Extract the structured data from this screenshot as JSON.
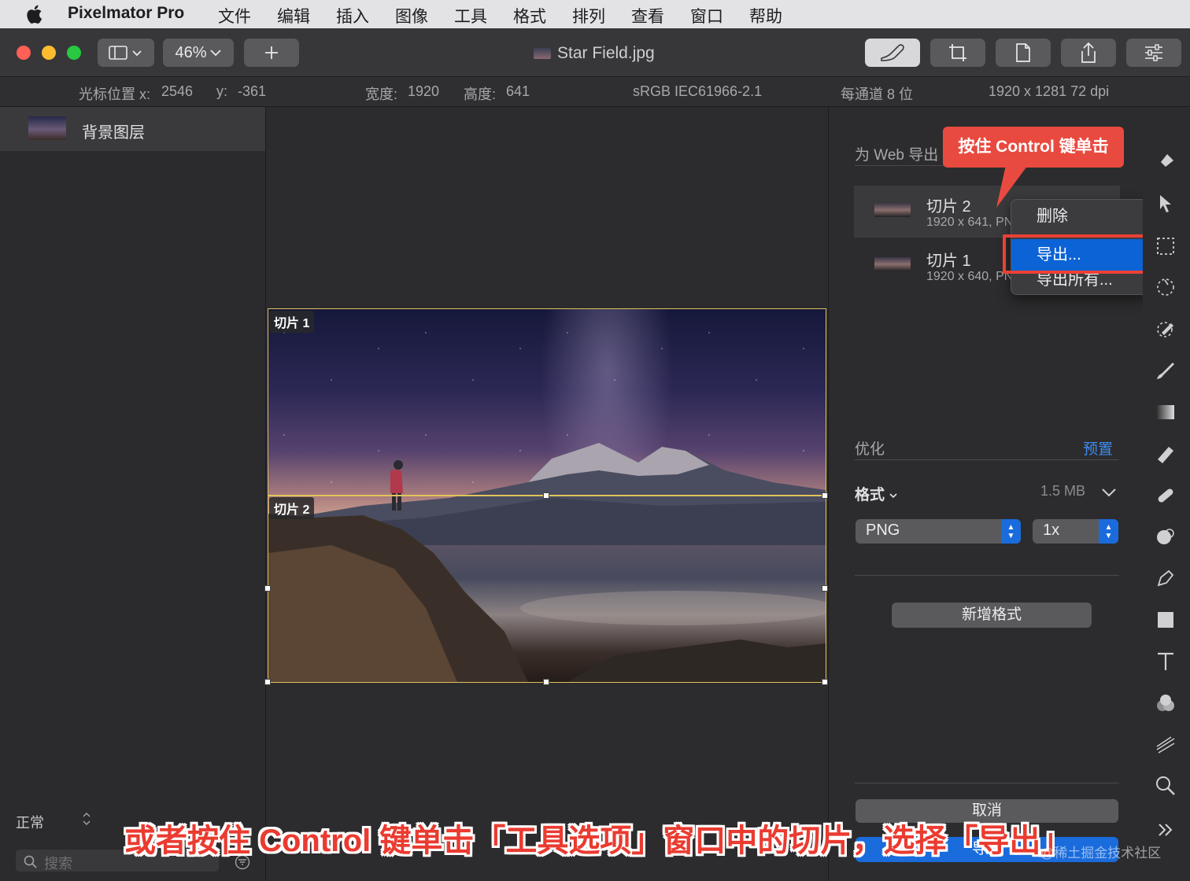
{
  "menubar": {
    "app_name": "Pixelmator Pro",
    "items": [
      "文件",
      "编辑",
      "插入",
      "图像",
      "工具",
      "格式",
      "排列",
      "查看",
      "窗口",
      "帮助"
    ]
  },
  "toolbar": {
    "zoom": "46%",
    "document_title": "Star Field.jpg",
    "traffic_colors": [
      "#fe5f57",
      "#febc2e",
      "#28c840"
    ]
  },
  "infobar": {
    "cursor_x_label": "光标位置 x:",
    "cursor_x": "2546",
    "cursor_y_label": "y:",
    "cursor_y": "-361",
    "width_label": "宽度:",
    "width": "1920",
    "height_label": "高度:",
    "height": "641",
    "color_profile": "sRGB IEC61966-2.1",
    "bit_depth": "每通道 8 位",
    "image_size": "1920 x 1281 72 dpi"
  },
  "layers": {
    "items": [
      {
        "name": "背景图层"
      }
    ],
    "blend_mode": "正常",
    "search_placeholder": "搜索"
  },
  "canvas": {
    "slice1_label": "切片 1",
    "slice2_label": "切片 2"
  },
  "export_panel": {
    "header": "为 Web 导出",
    "slices": [
      {
        "name": "切片 2",
        "dims": "1920 x 641, PNG"
      },
      {
        "name": "切片 1",
        "dims": "1920 x 640, PNG"
      }
    ],
    "optimize_label": "优化",
    "preset_link": "预置",
    "format_label": "格式",
    "file_size": "1.5 MB",
    "format_value": "PNG",
    "scale_value": "1x",
    "add_format_button": "新增格式",
    "cancel_button": "取消",
    "export_button": "导出"
  },
  "context_menu": {
    "items": [
      "删除",
      "导出...",
      "导出所有..."
    ],
    "selected_index": 1
  },
  "annotation": {
    "callout": "按住 Control 键单击",
    "caption": "或者按住 Control 键单击「工具选项」窗口中的切片，选择「导出」",
    "watermark": "@稀土掘金技术社区"
  },
  "colors": {
    "accent_blue": "#1a6bdc",
    "annotation_red": "#ea4135",
    "slice_outline": "#e2c35a"
  },
  "tools": [
    "shape-style-icon",
    "arrange-cursor-icon",
    "selection-icon",
    "magic-select-icon",
    "color-picker-icon",
    "paint-brush-icon",
    "gradient-icon",
    "eraser-icon",
    "repair-icon",
    "retouch-icon",
    "pen-icon",
    "rectangle-icon",
    "type-icon",
    "effects-icon",
    "distort-icon",
    "zoom-icon",
    "more-tools-icon"
  ]
}
